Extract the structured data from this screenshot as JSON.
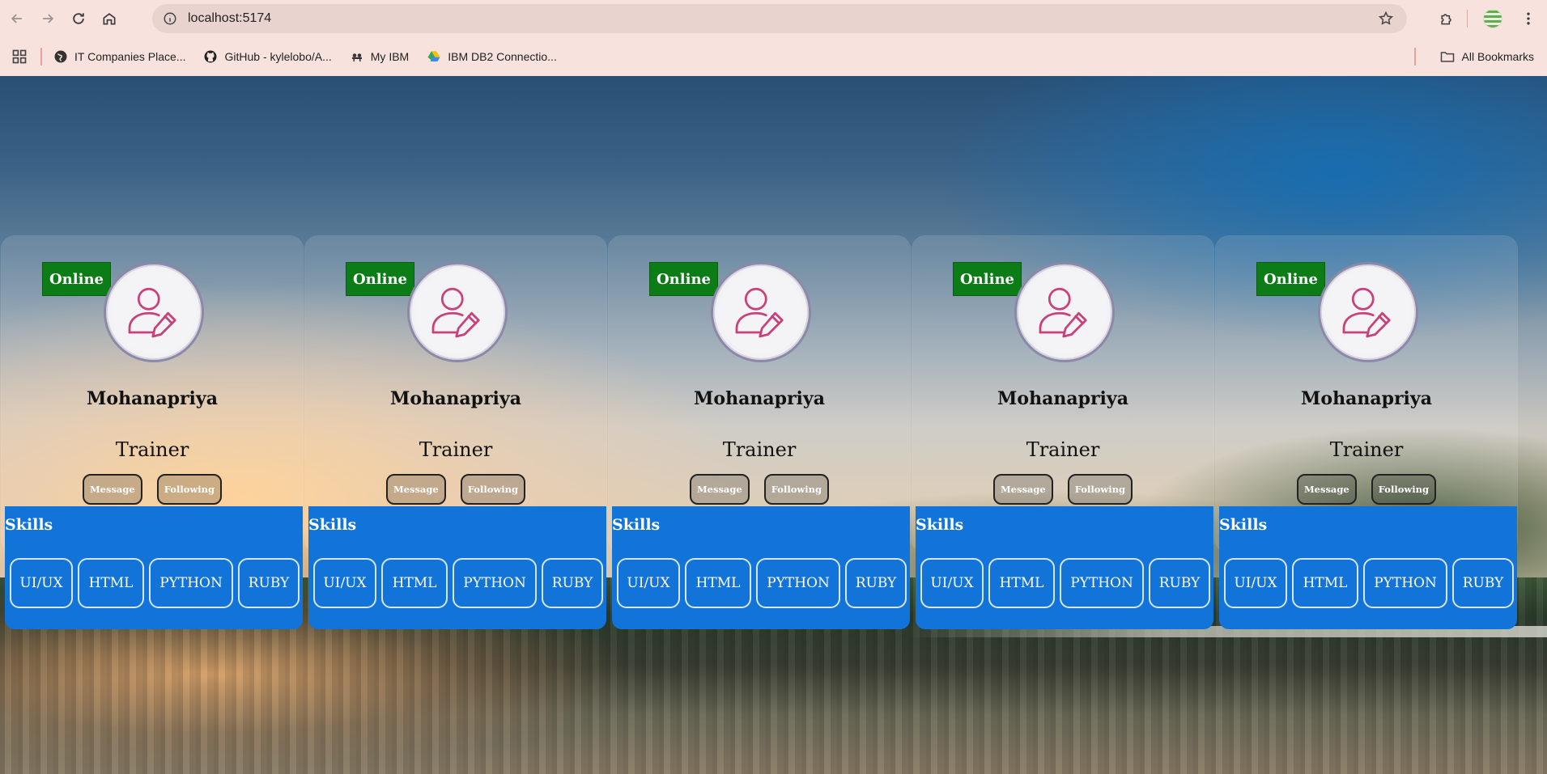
{
  "browser": {
    "url": "localhost:5174",
    "bookmarks": [
      {
        "label": "IT Companies Place...",
        "icon": "globe-icon"
      },
      {
        "label": "GitHub - kylelobo/A...",
        "icon": "github-icon"
      },
      {
        "label": "My IBM",
        "icon": "ibm-icon"
      },
      {
        "label": "IBM DB2 Connectio...",
        "icon": "google-drive-icon"
      }
    ],
    "all_bookmarks": "All Bookmarks"
  },
  "cards": [
    {
      "status": "Online",
      "name": "Mohanapriya",
      "role": "Trainer",
      "message": "Message",
      "following": "Following",
      "skills_title": "Skills",
      "skills": [
        "UI/UX",
        "HTML",
        "PYTHON",
        "RUBY"
      ]
    },
    {
      "status": "Online",
      "name": "Mohanapriya",
      "role": "Trainer",
      "message": "Message",
      "following": "Following",
      "skills_title": "Skills",
      "skills": [
        "UI/UX",
        "HTML",
        "PYTHON",
        "RUBY"
      ]
    },
    {
      "status": "Online",
      "name": "Mohanapriya",
      "role": "Trainer",
      "message": "Message",
      "following": "Following",
      "skills_title": "Skills",
      "skills": [
        "UI/UX",
        "HTML",
        "PYTHON",
        "RUBY"
      ]
    },
    {
      "status": "Online",
      "name": "Mohanapriya",
      "role": "Trainer",
      "message": "Message",
      "following": "Following",
      "skills_title": "Skills",
      "skills": [
        "UI/UX",
        "HTML",
        "PYTHON",
        "RUBY"
      ]
    },
    {
      "status": "Online",
      "name": "Mohanapriya",
      "role": "Trainer",
      "message": "Message",
      "following": "Following",
      "skills_title": "Skills",
      "skills": [
        "UI/UX",
        "HTML",
        "PYTHON",
        "RUBY"
      ]
    }
  ],
  "colors": {
    "badge": "#0c7d16",
    "skills_panel": "#1274d9",
    "avatar_icon": "#c9407a"
  }
}
